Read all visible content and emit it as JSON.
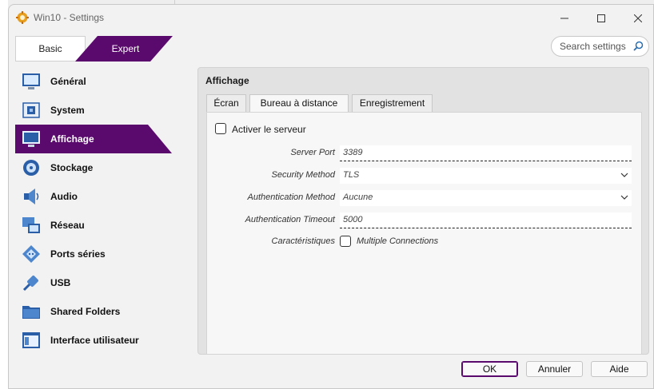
{
  "window": {
    "title": "Win10 - Settings"
  },
  "mode": {
    "basic_label": "Basic",
    "expert_label": "Expert"
  },
  "search": {
    "placeholder": "Search settings"
  },
  "sidebar": {
    "items": [
      {
        "label": "Général",
        "icon": "monitor-general-icon"
      },
      {
        "label": "System",
        "icon": "chip-icon"
      },
      {
        "label": "Affichage",
        "icon": "display-icon",
        "active": true
      },
      {
        "label": "Stockage",
        "icon": "disk-icon"
      },
      {
        "label": "Audio",
        "icon": "speaker-icon"
      },
      {
        "label": "Réseau",
        "icon": "network-icon"
      },
      {
        "label": "Ports séries",
        "icon": "serial-port-icon"
      },
      {
        "label": "USB",
        "icon": "usb-icon"
      },
      {
        "label": "Shared Folders",
        "icon": "folder-icon"
      },
      {
        "label": "Interface utilisateur",
        "icon": "window-ui-icon"
      }
    ]
  },
  "panel": {
    "title": "Affichage",
    "tabs": [
      {
        "label": "Écran"
      },
      {
        "label": "Bureau à distance",
        "active": true
      },
      {
        "label": "Enregistrement"
      }
    ],
    "enable_server_label": "Activer le serveur",
    "server_port": {
      "label": "Server Port",
      "value": "3389"
    },
    "security_method": {
      "label": "Security Method",
      "value": "TLS"
    },
    "auth_method": {
      "label": "Authentication Method",
      "value": "Aucune"
    },
    "auth_timeout": {
      "label": "Authentication Timeout",
      "value": "5000"
    },
    "features": {
      "label": "Caractéristiques",
      "option_label": "Multiple Connections"
    }
  },
  "buttons": {
    "ok": "OK",
    "cancel": "Annuler",
    "help": "Aide"
  },
  "colors": {
    "accent": "#5a0a6d"
  }
}
